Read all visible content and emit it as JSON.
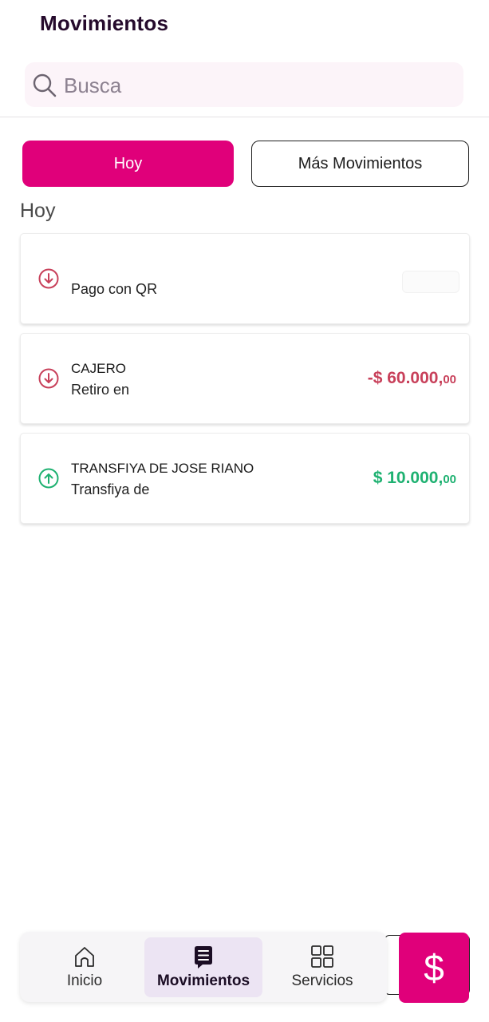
{
  "header": {
    "title": "Movimientos"
  },
  "search": {
    "placeholder": "Busca",
    "value": ""
  },
  "tabs": [
    {
      "label": "Hoy",
      "active": true
    },
    {
      "label": "Más Movimientos",
      "active": false
    }
  ],
  "section": {
    "label": "Hoy"
  },
  "movements": [
    {
      "direction": "out",
      "title": "",
      "subtitle": "Pago con QR",
      "amount": "",
      "amount_cents": "",
      "amount_visible": false
    },
    {
      "direction": "out",
      "title": "CAJERO",
      "subtitle": "Retiro en",
      "amount": "-$ 60.000,",
      "amount_cents": "00",
      "amount_visible": true
    },
    {
      "direction": "in",
      "title": "TRANSFIYA DE JOSE RIANO",
      "subtitle": "Transfiya de",
      "amount": "$ 10.000,",
      "amount_cents": "00",
      "amount_visible": true
    }
  ],
  "bottom_nav": {
    "items": [
      {
        "label": "Inicio",
        "icon": "home-icon",
        "active": false
      },
      {
        "label": "Movimientos",
        "icon": "document-icon",
        "active": true
      },
      {
        "label": "Servicios",
        "icon": "grid-icon",
        "active": false
      }
    ],
    "fab_label": "$"
  },
  "colors": {
    "brand": "#e0007a",
    "negative": "#c8405a",
    "positive": "#1eb171",
    "active_nav_bg": "#ece4f3"
  }
}
